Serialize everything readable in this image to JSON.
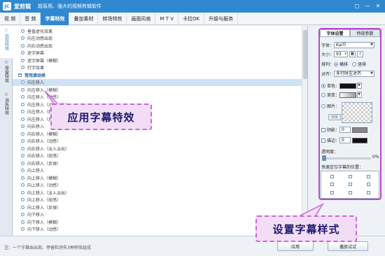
{
  "app": {
    "name": "爱剪辑",
    "logo_text": "JC",
    "slogan": "超易用、强大的视频剪辑软件",
    "window_buttons": [
      "◻",
      "—",
      "✕"
    ]
  },
  "menu": [
    {
      "label": "视 频"
    },
    {
      "label": "音 频"
    },
    {
      "label": "字幕特效",
      "active": true
    },
    {
      "label": "叠加素材"
    },
    {
      "label": "转场特效"
    },
    {
      "label": "画面风格"
    },
    {
      "label": "M T V"
    },
    {
      "label": "卡拉OK"
    },
    {
      "label": "升级与服务"
    }
  ],
  "vertical_tabs": [
    {
      "icon": "☆",
      "label": "出现特效",
      "active": true
    },
    {
      "icon": "☆",
      "label": "停留特效"
    },
    {
      "icon": "☆",
      "label": "消失特效"
    }
  ],
  "effects_list": [
    {
      "label": "垂直虚化效果"
    },
    {
      "label": "向左动感出现"
    },
    {
      "label": "向右动感出现"
    },
    {
      "label": "逐字屏幕"
    },
    {
      "label": "逐字屏幕（模糊）"
    },
    {
      "label": "打字效果"
    },
    {
      "label": "常用滚动类",
      "category": true
    },
    {
      "label": "向左移入",
      "selected": true
    },
    {
      "label": "向左移入（模糊）"
    },
    {
      "label": "向左移入（动感）"
    },
    {
      "label": "向左移入（淡入淡出）"
    },
    {
      "label": "向左移入（抛荡）"
    },
    {
      "label": "向左移入（反弹）"
    },
    {
      "label": "向右移入"
    },
    {
      "label": "向右移入（模糊）"
    },
    {
      "label": "向右移入（动感）"
    },
    {
      "label": "向右移入（淡入淡出）"
    },
    {
      "label": "向右移入（抛荡）"
    },
    {
      "label": "向右移入（反弹）"
    },
    {
      "label": "向上移入"
    },
    {
      "label": "向上移入（模糊）"
    },
    {
      "label": "向上移入（动感）"
    },
    {
      "label": "向上移入（淡入淡出）"
    },
    {
      "label": "向上移入（抛荡）"
    },
    {
      "label": "向上移入（反弹）"
    },
    {
      "label": "向下移入"
    },
    {
      "label": "向下移入（模糊）"
    },
    {
      "label": "向下移入（动感）"
    }
  ],
  "right_panel": {
    "tabs": [
      "字体设置",
      "特效参数"
    ],
    "font_label": "字体：",
    "font_value": "KaiTi",
    "size_label": "大小：",
    "size_value": "93",
    "bold_label": "B",
    "italic_label": "I",
    "layout_label": "排列：",
    "layout_horizontal": "横排",
    "layout_vertical": "竖排",
    "align_label": "对齐：",
    "align_value": "多行时左对齐",
    "solid_label": "单色：",
    "gradient_label": "渐变：",
    "image_label": "图片：",
    "browse_label": "浏览",
    "shadow_label": "阴影：",
    "shadow_value": "0",
    "stroke_label": "描边：",
    "stroke_value": "0",
    "opacity_label": "透明度：",
    "opacity_value": "0%",
    "opacity_fraction": 0.0,
    "quick_pos_label": "快速定位字幕的位置："
  },
  "bottom": {
    "note": "注：一个字幕由出现、停留和消失3种特效组成",
    "apply_label": "应用",
    "preview_label": "播放试试"
  },
  "callouts": {
    "apply_effect": "应用字幕特效",
    "set_style": "设置字幕样式"
  },
  "colors": {
    "accent": "#2f88d0",
    "highlight_border": "#b848d0",
    "callout_fill": "#f3dcf5",
    "callout_text": "#1c1c6e"
  }
}
